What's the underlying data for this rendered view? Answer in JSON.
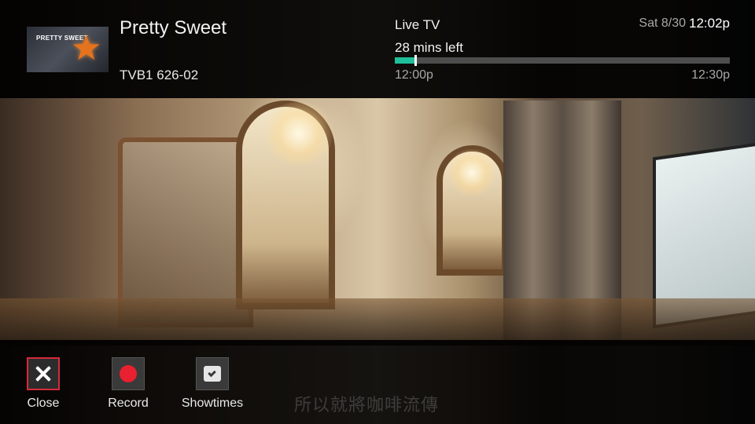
{
  "program": {
    "title": "Pretty Sweet",
    "channel": "TVB1 626-02",
    "thumbnail_text": "PRETTY SWEET",
    "thumbnail_icon": "star-icon"
  },
  "status": {
    "mode": "Live TV",
    "time_left": "28 mins left",
    "start_time": "12:00p",
    "end_time": "12:30p",
    "progress_fraction": 0.06,
    "date": "Sat 8/30",
    "clock": "12:02p"
  },
  "actions": [
    {
      "label": "Close",
      "icon": "close-icon",
      "focused": true
    },
    {
      "label": "Record",
      "icon": "record-icon",
      "focused": false
    },
    {
      "label": "Showtimes",
      "icon": "showtimes-icon",
      "focused": false
    }
  ],
  "subtitle": "所以就將咖啡流傳",
  "colors": {
    "progress_fill": "#1fbf9a",
    "focus_border": "#d62b3a",
    "record": "#e8202f"
  }
}
